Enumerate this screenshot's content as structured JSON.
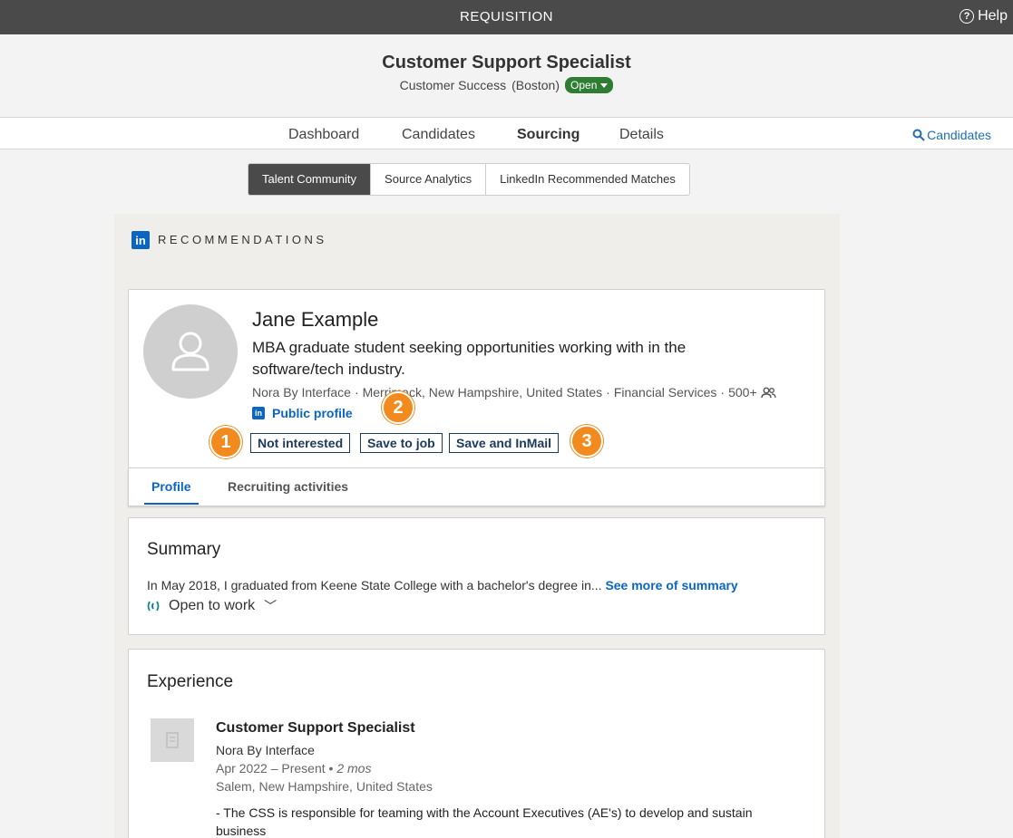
{
  "topbar": {
    "title": "REQUISITION",
    "help_label": "Help",
    "help_icon_glyph": "?"
  },
  "header": {
    "job_title": "Customer Support Specialist",
    "department": "Customer Success",
    "location": "(Boston)",
    "status": "Open"
  },
  "nav": {
    "tabs": [
      {
        "label": "Dashboard"
      },
      {
        "label": "Candidates"
      },
      {
        "label": "Sourcing",
        "active": true
      },
      {
        "label": "Details"
      }
    ],
    "search_label": "Candidates"
  },
  "subtabs": [
    {
      "label": "Talent Community",
      "active": true
    },
    {
      "label": "Source Analytics"
    },
    {
      "label": "LinkedIn Recommended Matches"
    }
  ],
  "recommendations": {
    "label": "RECOMMENDATIONS",
    "badge": "in",
    "candidate": {
      "name": "Jane Example",
      "headline": "MBA graduate student seeking opportunities working with in the software/tech industry.",
      "company": "Nora By Interface",
      "location": "Merrimack, New Hampshire, United States",
      "industry": "Financial Services",
      "connections": "500+",
      "public_profile_label": "Public profile",
      "actions": {
        "not_interested": "Not interested",
        "save_to_job": "Save to job",
        "save_and_inmail": "Save and InMail"
      },
      "markers": [
        "1",
        "2",
        "3"
      ]
    },
    "profile_tabs": [
      {
        "label": "Profile",
        "active": true
      },
      {
        "label": "Recruiting activities"
      }
    ],
    "summary": {
      "title": "Summary",
      "text": "In May 2018, I graduated from Keene State College with a bachelor's degree in...",
      "see_more": "See more of summary",
      "open_to_work": "Open to work",
      "open_to_work_chevron": "﹀"
    },
    "experience": {
      "title": "Experience",
      "items": [
        {
          "title": "Customer Support Specialist",
          "company": "Nora By Interface",
          "dates": "Apr 2022 – Present",
          "duration": "2 mos",
          "location": "Salem, New Hampshire, United States",
          "description": "- The CSS is responsible for teaming with the Account Executives (AE's) to develop and sustain business"
        }
      ]
    }
  },
  "colors": {
    "linkedin_blue": "#0a66c2",
    "topbar": "#4a4a4a",
    "status_green": "#2e7d32",
    "marker_orange": "#f28a1e"
  }
}
